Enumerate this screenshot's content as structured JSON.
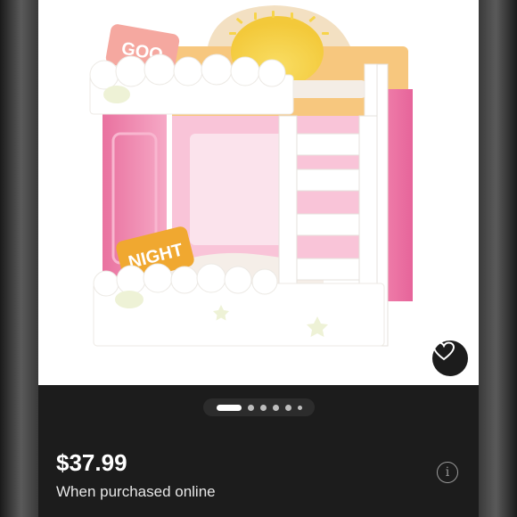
{
  "product_image": {
    "pillow_top_text": "GOO",
    "pillow_bottom_text": "NIGHT"
  },
  "carousel": {
    "count": 6,
    "active_index": 0
  },
  "listing": {
    "price": "$37.99",
    "price_note": "When purchased online"
  },
  "icons": {
    "favorite": "heart-icon",
    "info": "info-icon"
  },
  "colors": {
    "panel_bg": "#1c1c1c",
    "pink_acrylic": "#f07fa8",
    "sun_yellow": "#f7d44a",
    "pillow_orange": "#f0a830",
    "pillow_pink": "#f5a8a0"
  }
}
